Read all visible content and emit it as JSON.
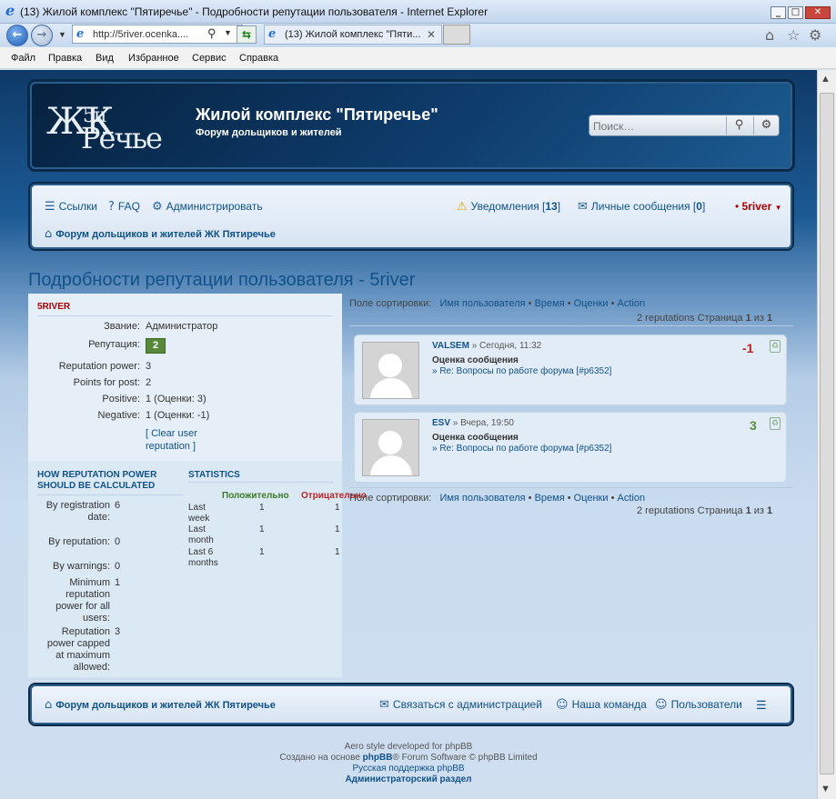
{
  "browser": {
    "title": "(13) Жилой комплекс \"Пятиречье\" - Подробности репутации пользователя - Internet Explorer",
    "address": "http://5river.ocenka....",
    "tab_title": "(13) Жилой комплекс \"Пяти...",
    "menu": [
      "Файл",
      "Правка",
      "Вид",
      "Избранное",
      "Сервис",
      "Справка"
    ]
  },
  "header": {
    "logo": {
      "a": "ЖК",
      "b": "5и",
      "c": "Речье"
    },
    "site_name": "Жилой комплекс \"Пятиречье\"",
    "site_desc": "Форум дольщиков и жителей",
    "search_placeholder": "Поиск…"
  },
  "nav": {
    "links": "Ссылки",
    "faq": "FAQ",
    "admin": "Администрировать",
    "notifications": "Уведомления",
    "notif_count": "13",
    "pm": "Личные сообщения",
    "pm_count": "0",
    "user": "5river",
    "forum": "Форум дольщиков и жителей ЖК Пятиречье"
  },
  "page": {
    "title": "Подробности репутации пользователя - 5river"
  },
  "profile": {
    "username": "5RIVER",
    "rows": [
      {
        "label": "Звание:",
        "value": "Администратор"
      },
      {
        "label": "Репутация:",
        "value": "2"
      },
      {
        "label": "Reputation power:",
        "value": "3"
      },
      {
        "label": "Points for post:",
        "value": "2"
      },
      {
        "label": "Positive:",
        "value": "1 (Оценки: 3)"
      },
      {
        "label": "Negative:",
        "value": "1 (Оценки: -1)"
      }
    ],
    "clear": "[ Clear user reputation ]"
  },
  "how_power": {
    "heading": "HOW REPUTATION POWER SHOULD BE CALCULATED",
    "rows": [
      {
        "label": "By registration date:",
        "value": "6"
      },
      {
        "label": "By reputation:",
        "value": "0"
      },
      {
        "label": "By warnings:",
        "value": "0"
      },
      {
        "label": "Minimum reputation power for all users:",
        "value": "1"
      },
      {
        "label": "Reputation power capped at maximum allowed:",
        "value": "3"
      }
    ]
  },
  "statistics": {
    "heading": "STATISTICS",
    "col_pos": "Положительно",
    "col_neg": "Отрицательно",
    "rows": [
      {
        "label": "Last week",
        "pos": "1",
        "neg": "1"
      },
      {
        "label": "Last month",
        "pos": "1",
        "neg": "1"
      },
      {
        "label": "Last 6 months",
        "pos": "1",
        "neg": "1"
      }
    ]
  },
  "sort": {
    "label": "Поле сортировки:",
    "options": [
      "Имя пользователя",
      "Время",
      "Оценки",
      "Action"
    ],
    "pagination": "2 reputations Страница 1 из 1",
    "pagination_parts": {
      "pre": "2 reputations Страница ",
      "cur": "1",
      "mid": " из ",
      "total": "1"
    }
  },
  "reputations": [
    {
      "user": "VALSEM",
      "time": "» Сегодня, 11:32",
      "title": "Оценка сообщения",
      "link": "» Re: Вопросы по работе форума [#p6352]",
      "points": "-1",
      "color": "#bb2222"
    },
    {
      "user": "ESV",
      "time": "» Вчера, 19:50",
      "title": "Оценка сообщения",
      "link": "» Re: Вопросы по работе форума [#p6352]",
      "points": "3",
      "color": "#568a3a"
    }
  ],
  "footer": {
    "forum": "Форум дольщиков и жителей ЖК Пятиречье",
    "contact": "Связаться с администрацией",
    "team": "Наша команда",
    "members": "Пользователи",
    "aero_credit": "Aero style developed for phpBB",
    "created_pre": "Создано на основе ",
    "created_phpbb": "phpBB",
    "created_post": "® Forum Software © phpBB Limited",
    "ru_support": "Русская поддержка phpBB",
    "admin_panel": "Администраторский раздел"
  }
}
